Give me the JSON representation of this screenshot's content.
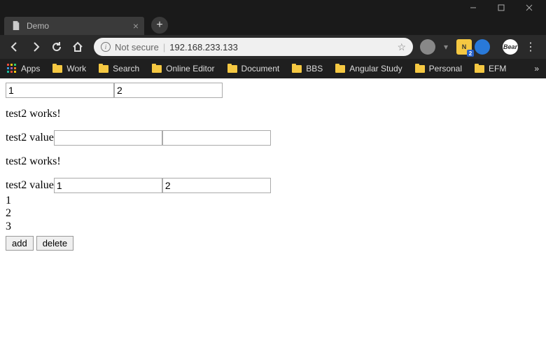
{
  "window": {
    "tab_title": "Demo"
  },
  "address": {
    "security_text": "Not secure",
    "url": "192.168.233.133"
  },
  "bookmarks": {
    "apps": "Apps",
    "items": [
      "Work",
      "Search",
      "Online Editor",
      "Document",
      "BBS",
      "Angular Study",
      "Personal",
      "EFM"
    ]
  },
  "ext_badge": "2",
  "page": {
    "top_inputs": [
      "1",
      "2"
    ],
    "block1": {
      "works": "test2 works!",
      "label": "test2 value",
      "inputs": [
        "",
        ""
      ]
    },
    "block2": {
      "works": "test2 works!",
      "label": "test2 value",
      "inputs": [
        "1",
        "2"
      ]
    },
    "list": [
      "1",
      "2",
      "3"
    ],
    "buttons": {
      "add": "add",
      "delete": "delete"
    }
  }
}
